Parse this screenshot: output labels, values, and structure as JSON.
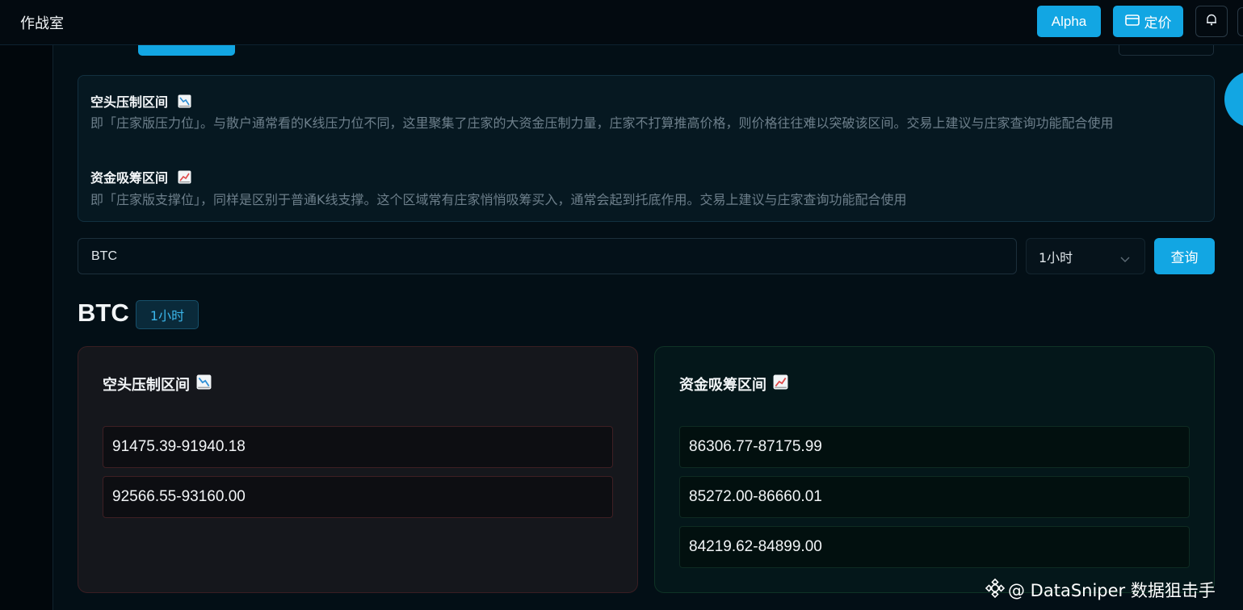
{
  "header": {
    "app_title": "作战室",
    "alpha_label": "Alpha",
    "pricing_label": "定价",
    "pricing_icon": "card-icon",
    "bell_icon": "bell-icon"
  },
  "info": {
    "short_title": "空头压制区间",
    "short_icon": "chart-decreasing-icon",
    "short_desc": "即「庄家版压力位」。与散户通常看的K线压力位不同，这里聚集了庄家的大资金压制力量，庄家不打算推高价格，则价格往往难以突破该区间。交易上建议与庄家查询功能配合使用",
    "long_title": "资金吸筹区间",
    "long_icon": "chart-increasing-icon",
    "long_desc": "即「庄家版支撑位」，同样是区别于普通K线支撑。这个区域常有庄家悄悄吸筹买入，通常会起到托底作用。交易上建议与庄家查询功能配合使用"
  },
  "search": {
    "value": "BTC",
    "interval": "1小时",
    "query_label": "查询"
  },
  "result": {
    "symbol": "BTC",
    "interval_badge": "1小时",
    "short_panel": {
      "title": "空头压制区间",
      "ranges": [
        "91475.39-91940.18",
        "92566.55-93160.00"
      ]
    },
    "long_panel": {
      "title": "资金吸筹区间",
      "ranges": [
        "86306.77-87175.99",
        "85272.00-86660.01",
        "84219.62-84899.00"
      ]
    }
  },
  "watermark": {
    "text": "@ DataSniper 数据狙击手"
  },
  "colors": {
    "accent": "#12a6e3",
    "short_border": "#3e1f23",
    "long_border": "#0f3326"
  }
}
